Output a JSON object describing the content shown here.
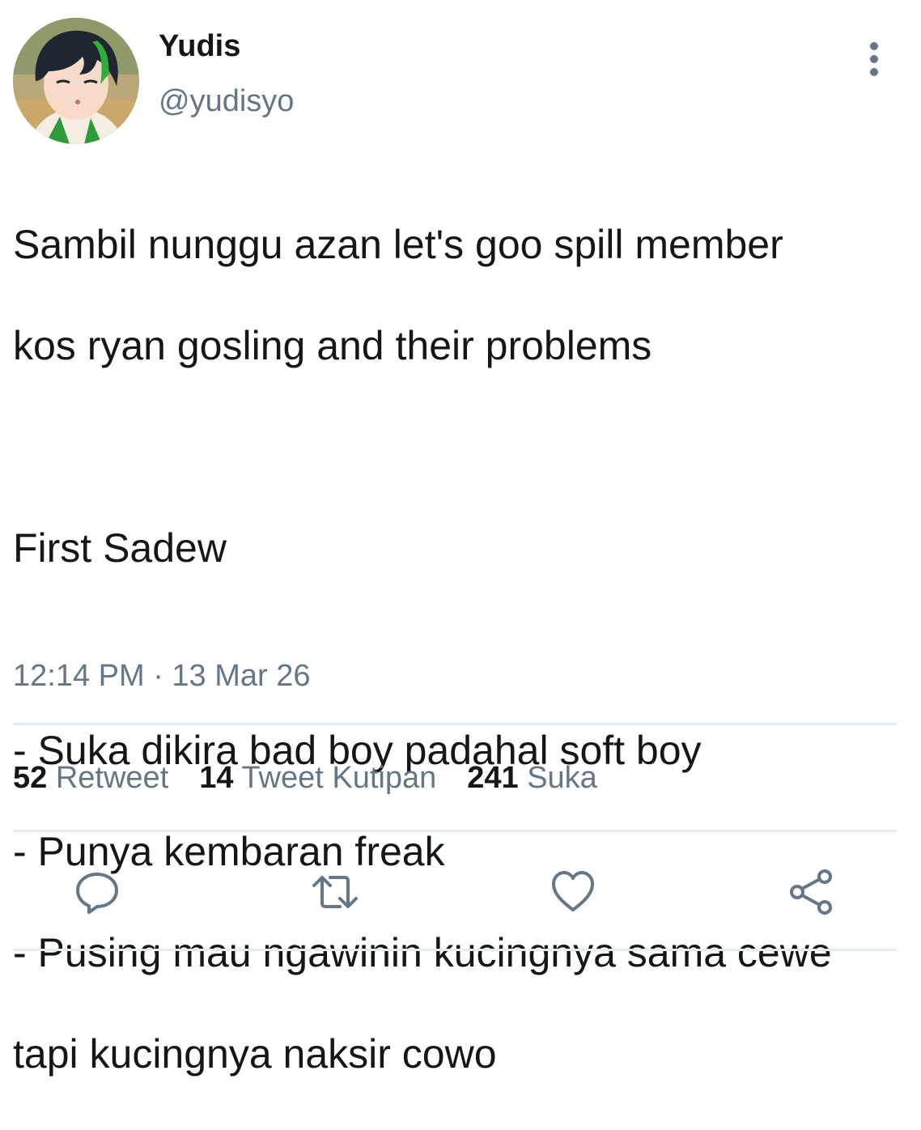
{
  "author": {
    "display_name": "Yudis",
    "handle": "@yudisyo",
    "avatar_icon": "avatar-illustration"
  },
  "tweet": {
    "lines": [
      "Sambil nunggu azan let's goo spill member",
      "kos ryan gosling and their problems",
      "",
      "First Sadew",
      "",
      "- Suka dikira bad boy padahal soft boy",
      "- Punya kembaran freak",
      "- Pusing mau ngawinin kucingnya sama cewe",
      "tapi kucingnya naksir cowo"
    ],
    "timestamp": "12:14 PM · 13 Mar 26"
  },
  "stats": {
    "retweets": {
      "count": "52",
      "label": "Retweet"
    },
    "quotes": {
      "count": "14",
      "label": "Tweet Kutipan"
    },
    "likes": {
      "count": "241",
      "label": "Suka"
    }
  },
  "actions": {
    "reply_icon": "reply-icon",
    "retweet_icon": "retweet-icon",
    "like_icon": "heart-icon",
    "share_icon": "share-icon"
  },
  "colors": {
    "text_primary": "#14171a",
    "text_secondary": "#657786",
    "divider": "#e6ecf0"
  }
}
